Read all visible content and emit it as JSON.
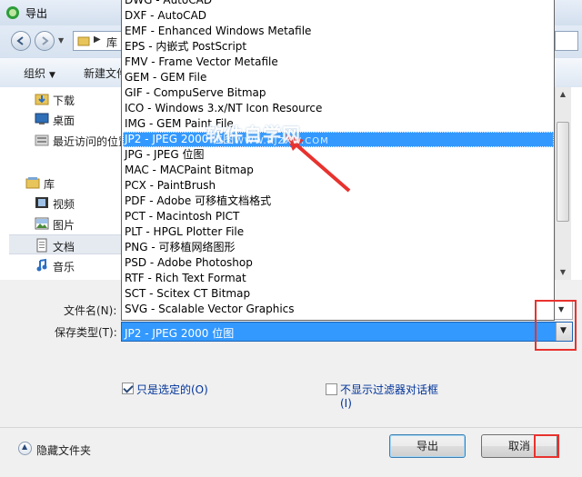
{
  "window": {
    "title": "导出"
  },
  "address": {
    "crumb": "库"
  },
  "commands": {
    "organize": "组织",
    "new_folder": "新建文件夹"
  },
  "nav": {
    "items": [
      {
        "label": "下载",
        "icon": "downloads-folder-icon"
      },
      {
        "label": "桌面",
        "icon": "desktop-icon"
      },
      {
        "label": "最近访问的位置",
        "icon": "recent-places-icon"
      },
      {
        "label": "库",
        "icon": "libraries-icon"
      },
      {
        "label": "视频",
        "icon": "videos-icon"
      },
      {
        "label": "图片",
        "icon": "pictures-icon"
      },
      {
        "label": "文档",
        "icon": "documents-icon"
      },
      {
        "label": "音乐",
        "icon": "music-icon"
      }
    ]
  },
  "dropdown": {
    "items": [
      "DWG - AutoCAD",
      "DXF - AutoCAD",
      "EMF - Enhanced Windows Metafile",
      "EPS - 内嵌式 PostScript",
      "FMV - Frame Vector Metafile",
      "GEM - GEM File",
      "GIF - CompuServe Bitmap",
      "ICO - Windows 3.x/NT Icon Resource",
      "IMG - GEM Paint File",
      "JP2 - JPEG 2000 位图",
      "JPG - JPEG 位图",
      "MAC - MACPaint Bitmap",
      "PCX - PaintBrush",
      "PDF - Adobe 可移植文档格式",
      "PCT - Macintosh PICT",
      "PLT - HPGL Plotter File",
      "PNG - 可移植网络图形",
      "PSD - Adobe Photoshop",
      "RTF - Rich Text Format",
      "SCT - Scitex CT Bitmap",
      "SVG - Scalable Vector Graphics"
    ],
    "selected_index": 9
  },
  "form": {
    "filename_label": "文件名(N):",
    "filename_value": "",
    "filetype_label": "保存类型(T):",
    "filetype_value": "JP2 - JPEG 2000 位图"
  },
  "options": {
    "selected_only_label": "只是选定的(O)",
    "selected_only_checked": true,
    "no_filter_dialog_label_line1": "不显示过滤器对话框",
    "no_filter_dialog_label_line2": "(I)",
    "no_filter_dialog_checked": false
  },
  "footer": {
    "hide_folders_label": "隐藏文件夹",
    "export_button": "导出",
    "cancel_button": "取消"
  },
  "watermark": {
    "main": "软件自学网",
    "sub": "WWW.RJZXW.COM"
  },
  "colors": {
    "highlight": "#3399ff",
    "annotation_red": "#e8322e",
    "link_blue": "#003399"
  }
}
